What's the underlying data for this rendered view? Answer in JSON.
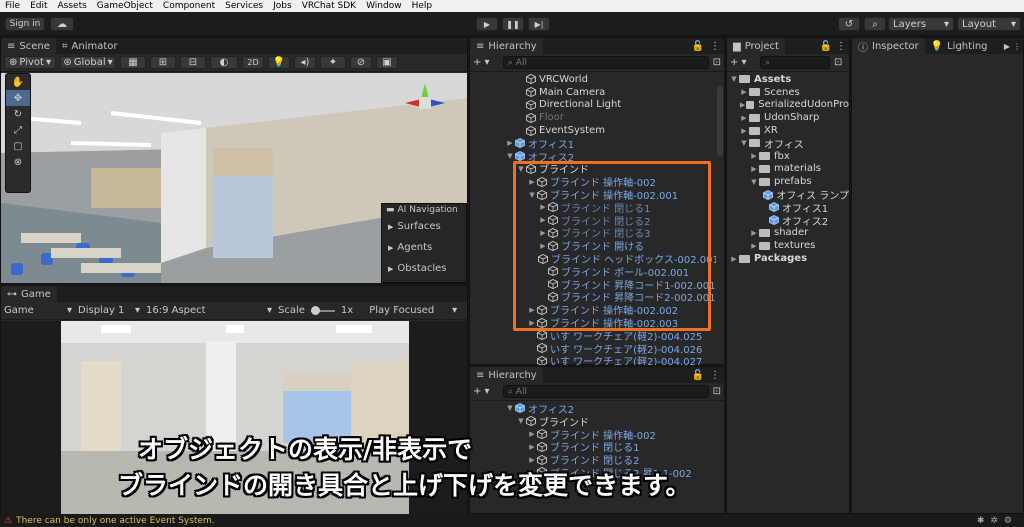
{
  "menu": [
    "File",
    "Edit",
    "Assets",
    "GameObject",
    "Component",
    "Services",
    "Jobs",
    "VRChat SDK",
    "Window",
    "Help"
  ],
  "toolbar": {
    "sign_in": "Sign in",
    "layers": "Layers",
    "layout": "Layout"
  },
  "scene": {
    "tabs": [
      "Scene",
      "Animator"
    ],
    "pivot": "Pivot",
    "global": "Global",
    "mode_2d": "2D",
    "ai_nav": {
      "title": "AI Navigation",
      "items": [
        "Surfaces",
        "Agents",
        "Obstacles"
      ]
    }
  },
  "game": {
    "tab": "Game",
    "display_label": "Game",
    "display": "Display 1",
    "aspect": "16:9 Aspect",
    "scale_label": "Scale",
    "scale_value": "1x",
    "play_mode": "Play Focused"
  },
  "hierarchy": {
    "title": "Hierarchy",
    "search_placeholder": "All",
    "rows": [
      {
        "label": "VRCWorld",
        "indent": 2,
        "style": "white",
        "arrow": ""
      },
      {
        "label": "Main Camera",
        "indent": 2,
        "style": "white",
        "arrow": ""
      },
      {
        "label": "Directional Light",
        "indent": 2,
        "style": "white",
        "arrow": ""
      },
      {
        "label": "Floor",
        "indent": 2,
        "style": "dim",
        "arrow": ""
      },
      {
        "label": "EventSystem",
        "indent": 2,
        "style": "white",
        "arrow": ""
      },
      {
        "label": "オフィス1",
        "indent": 1,
        "style": "blue",
        "arrow": "▶"
      },
      {
        "label": "オフィス2",
        "indent": 1,
        "style": "blue",
        "arrow": "▼"
      },
      {
        "label": "ブラインド",
        "indent": 2,
        "style": "white",
        "arrow": "▼"
      },
      {
        "label": "ブラインド 操作軸-002",
        "indent": 3,
        "style": "blue",
        "arrow": "▶"
      },
      {
        "label": "ブラインド 操作軸-002.001",
        "indent": 3,
        "style": "blue",
        "arrow": "▼"
      },
      {
        "label": "ブラインド 閉じる1",
        "indent": 4,
        "style": "bluedim",
        "arrow": "▶"
      },
      {
        "label": "ブラインド 閉じる2",
        "indent": 4,
        "style": "bluedim",
        "arrow": "▶"
      },
      {
        "label": "ブラインド 閉じる3",
        "indent": 4,
        "style": "bluedim",
        "arrow": "▶"
      },
      {
        "label": "ブラインド 開ける",
        "indent": 4,
        "style": "blue",
        "arrow": "▶"
      },
      {
        "label": "ブラインド ヘッドボックス-002.001",
        "indent": 4,
        "style": "blue",
        "arrow": ""
      },
      {
        "label": "ブラインド ポール-002.001",
        "indent": 4,
        "style": "blue",
        "arrow": ""
      },
      {
        "label": "ブラインド 昇降コード1-002.001",
        "indent": 4,
        "style": "blue",
        "arrow": ""
      },
      {
        "label": "ブラインド 昇降コード2-002.001",
        "indent": 4,
        "style": "blue",
        "arrow": ""
      },
      {
        "label": "ブラインド 操作軸-002.002",
        "indent": 3,
        "style": "blue",
        "arrow": "▶"
      },
      {
        "label": "ブラインド 操作軸-002.003",
        "indent": 3,
        "style": "blue",
        "arrow": "▶"
      },
      {
        "label": "いす ワークチェア(軽2)-004.025",
        "indent": 3,
        "style": "blue",
        "arrow": ""
      },
      {
        "label": "いす ワークチェア(軽2)-004.026",
        "indent": 3,
        "style": "blue",
        "arrow": ""
      },
      {
        "label": "いす ワークチェア(軽2)-004.027",
        "indent": 3,
        "style": "blue",
        "arrow": ""
      }
    ]
  },
  "hierarchy2": {
    "title": "Hierarchy",
    "search_placeholder": "All",
    "rows": [
      {
        "label": "オフィス2",
        "indent": 1,
        "style": "blue",
        "arrow": "▼"
      },
      {
        "label": "ブラインド",
        "indent": 2,
        "style": "white",
        "arrow": "▼"
      },
      {
        "label": "ブラインド 操作軸-002",
        "indent": 3,
        "style": "blue",
        "arrow": "▶"
      },
      {
        "label": "ブラインド 閉じる1",
        "indent": 3,
        "style": "blue",
        "arrow": "▶"
      },
      {
        "label": "ブラインド 閉じる2",
        "indent": 3,
        "style": "blue",
        "arrow": "▶"
      },
      {
        "label": "ブラインド 閉じる2 昇1-1-002",
        "indent": 3,
        "style": "blue",
        "arrow": "▶"
      }
    ]
  },
  "project": {
    "title": "Project",
    "tree": [
      {
        "label": "Assets",
        "indent": 0,
        "arrow": "▼",
        "bold": true
      },
      {
        "label": "Scenes",
        "indent": 1,
        "arrow": "▶"
      },
      {
        "label": "SerializedUdonPro",
        "indent": 1,
        "arrow": "▶"
      },
      {
        "label": "UdonSharp",
        "indent": 1,
        "arrow": "▶"
      },
      {
        "label": "XR",
        "indent": 1,
        "arrow": "▶"
      },
      {
        "label": "オフィス",
        "indent": 1,
        "arrow": "▼"
      },
      {
        "label": "fbx",
        "indent": 2,
        "arrow": "▶"
      },
      {
        "label": "materials",
        "indent": 2,
        "arrow": "▶"
      },
      {
        "label": "prefabs",
        "indent": 2,
        "arrow": "▼"
      },
      {
        "label": "オフィス ランプ",
        "indent": 3,
        "arrow": "",
        "prefab": true
      },
      {
        "label": "オフィス1",
        "indent": 3,
        "arrow": "",
        "prefab": true
      },
      {
        "label": "オフィス2",
        "indent": 3,
        "arrow": "",
        "prefab": true
      },
      {
        "label": "shader",
        "indent": 2,
        "arrow": "▶"
      },
      {
        "label": "textures",
        "indent": 2,
        "arrow": "▶"
      },
      {
        "label": "Packages",
        "indent": 0,
        "arrow": "▶",
        "bold": true
      }
    ]
  },
  "inspector": {
    "tabs": [
      "Inspector",
      "Lighting"
    ]
  },
  "caption": {
    "line1": "オブジェクトの表示/非表示で",
    "line2": "ブラインドの開き具合と上げ下げを変更できます。"
  },
  "status": {
    "message": "There can be only one active Event System."
  },
  "colors": {
    "highlight": "#f07020",
    "accent_blue": "#7aa8e8"
  }
}
